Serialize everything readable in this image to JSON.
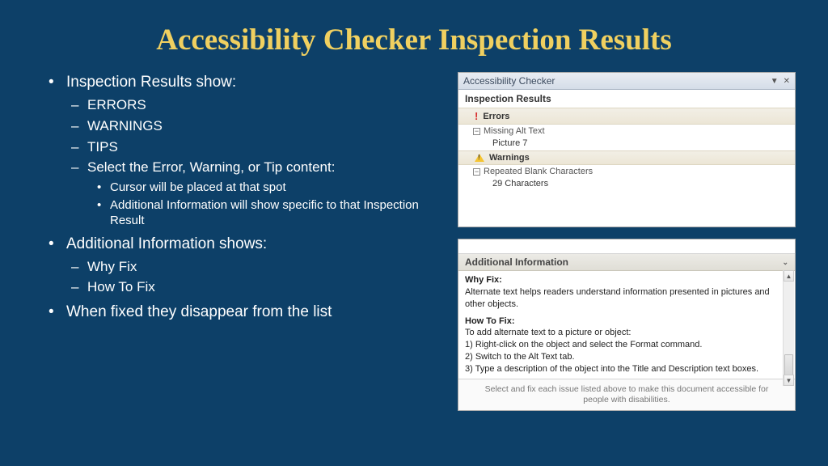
{
  "title": "Accessibility Checker Inspection Results",
  "bullets": {
    "b1": "Inspection Results show:",
    "b1a": "ERRORS",
    "b1b": "WARNINGS",
    "b1c": "TIPS",
    "b1d": "Select the Error, Warning, or Tip content:",
    "b1d1": "Cursor will be placed at that spot",
    "b1d2": "Additional Information will show specific to that Inspection Result",
    "b2": "Additional Information shows:",
    "b2a": "Why Fix",
    "b2b": "How To Fix",
    "b3": "When fixed they disappear from the list"
  },
  "panel1": {
    "title": "Accessibility Checker",
    "subheader": "Inspection Results",
    "cat_errors": "Errors",
    "err_item": "Missing Alt Text",
    "err_child": "Picture 7",
    "cat_warnings": "Warnings",
    "warn_item": "Repeated Blank Characters",
    "warn_child": "29 Characters"
  },
  "panel2": {
    "header": "Additional Information",
    "whyfix_label": "Why Fix:",
    "whyfix_text": "Alternate text helps readers understand information presented in pictures and other objects.",
    "howto_label": "How To Fix:",
    "howto_intro": "To add alternate text to a picture or object:",
    "howto_1": "1) Right-click on the object and select the Format command.",
    "howto_2": "2) Switch to the Alt Text tab.",
    "howto_3": "3) Type a description of the object into the Title and Description text boxes.",
    "footer": "Select and fix each issue listed above to make this document accessible for people with disabilities."
  }
}
